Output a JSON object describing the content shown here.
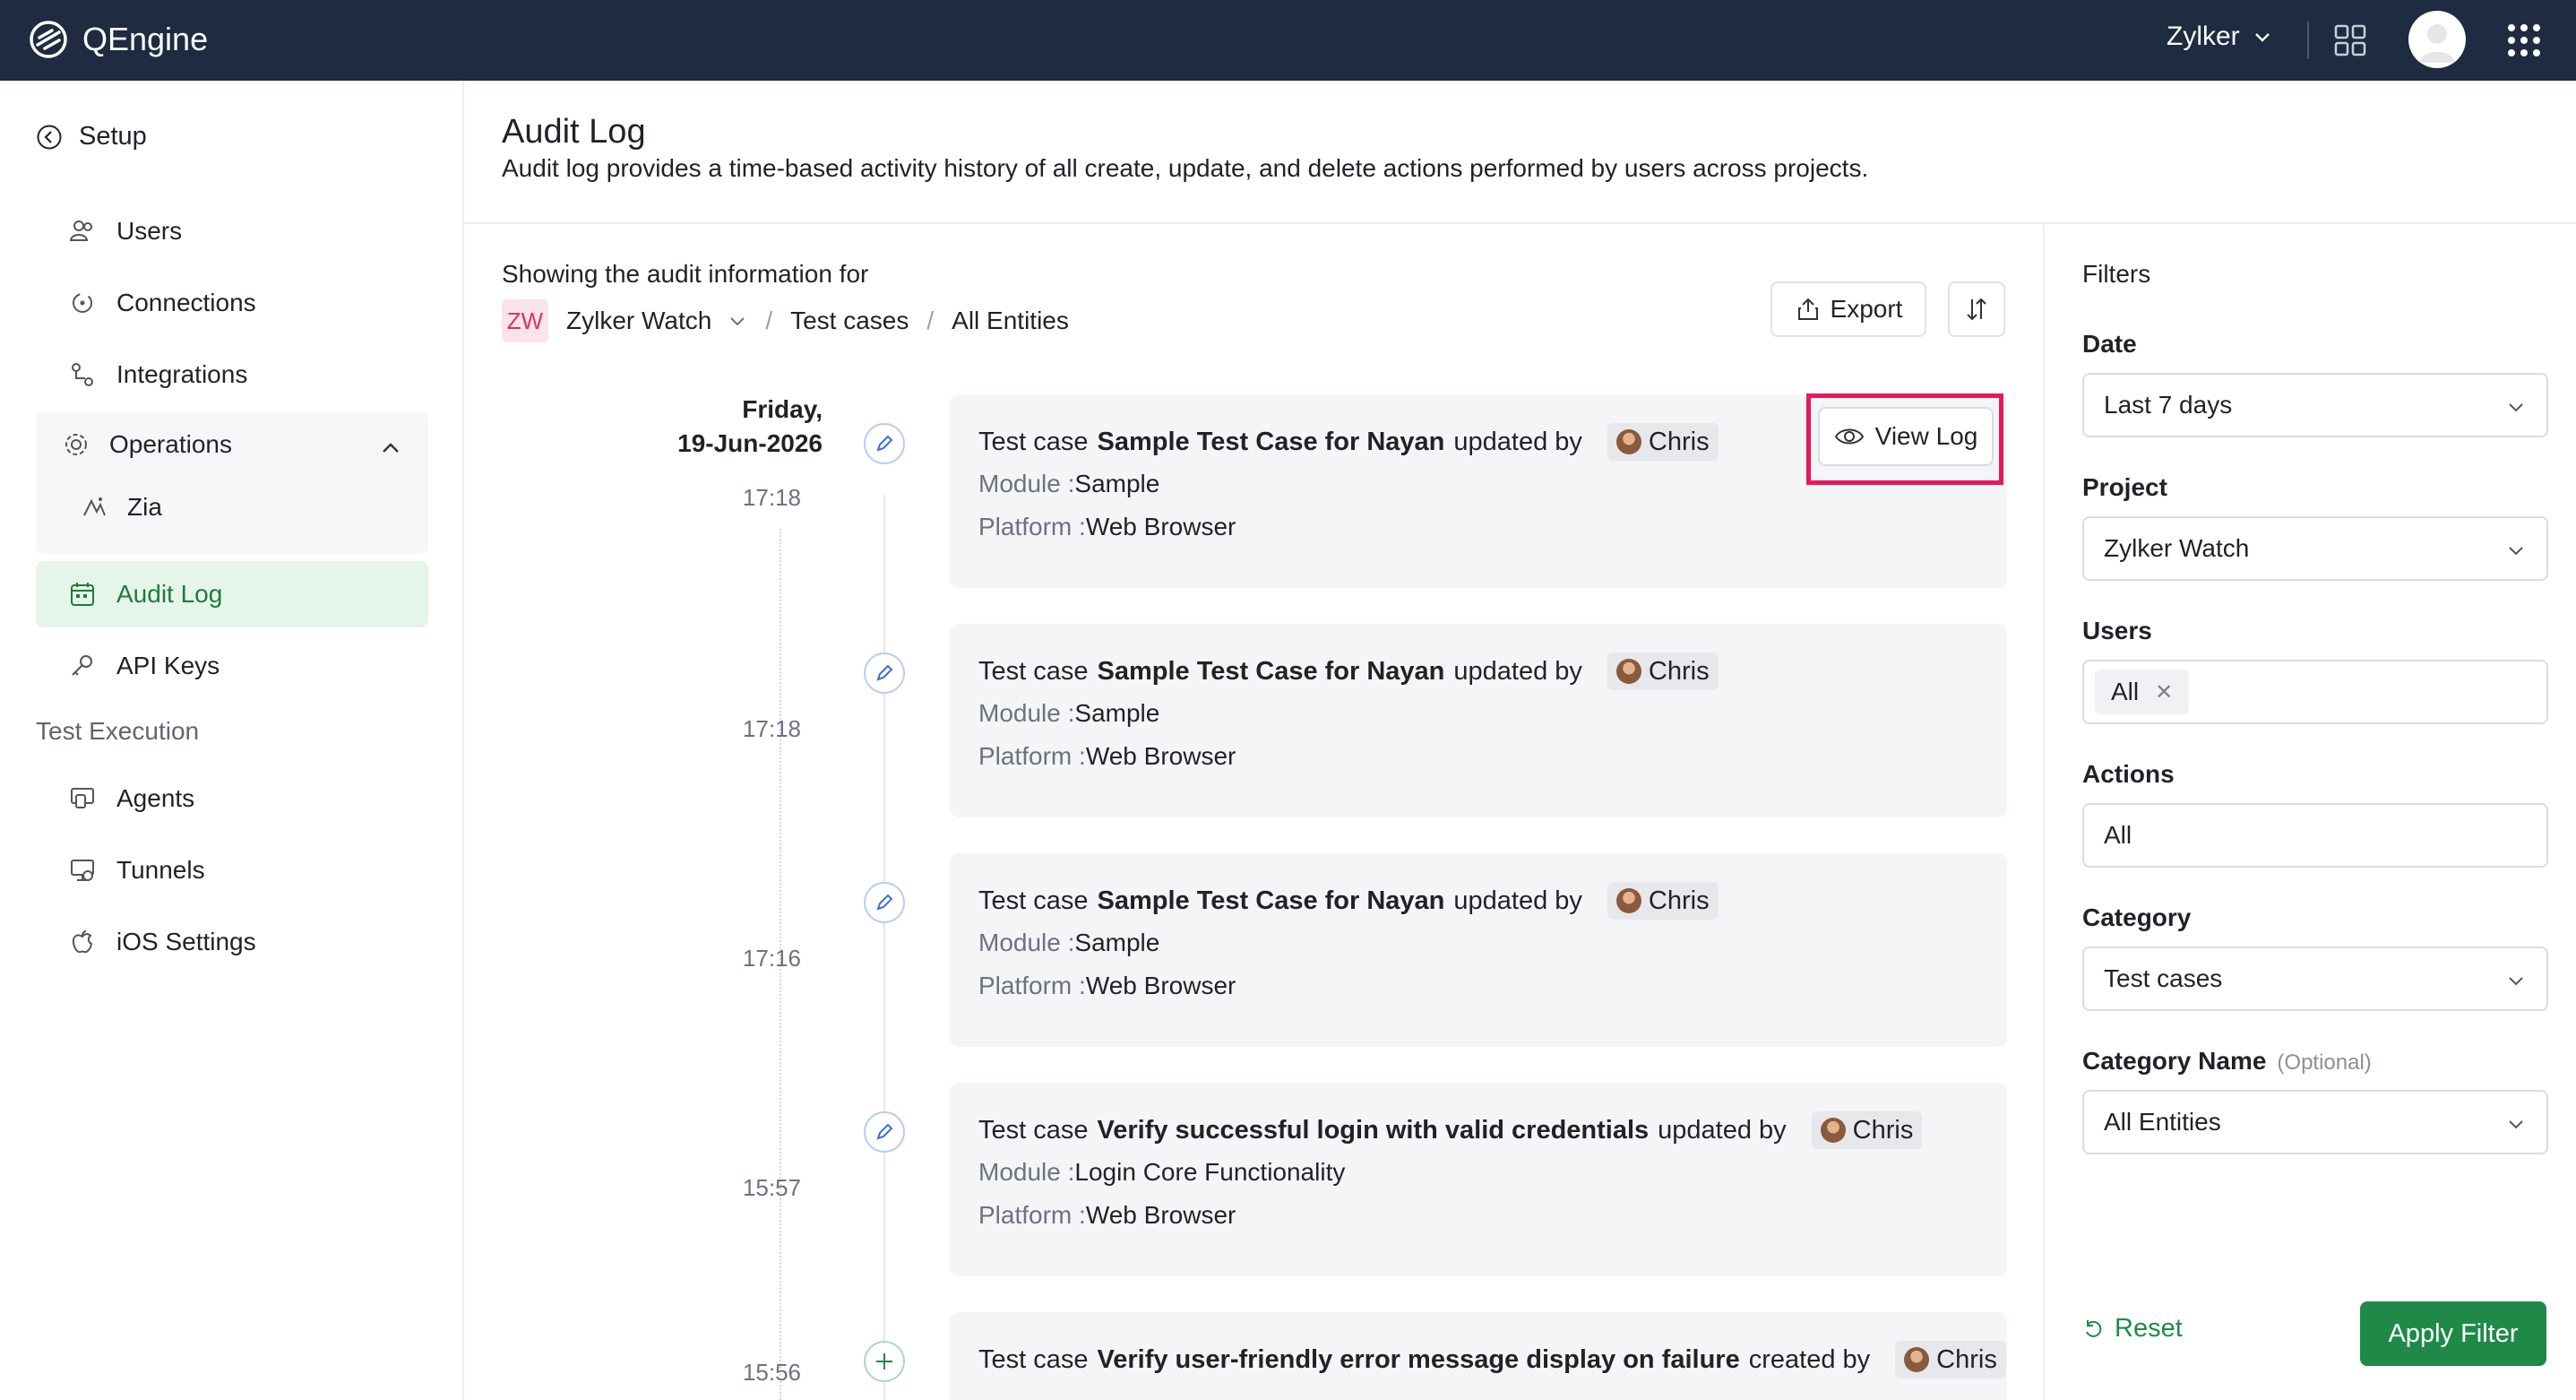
{
  "app": {
    "name": "QEngine",
    "org": "Zylker",
    "colors": {
      "topbar": "#1e2b40",
      "accent": "#1f8a47",
      "highlight": "#e8185a",
      "badge": "#d6336c"
    }
  },
  "sidebar": {
    "setup_label": "Setup",
    "items": [
      {
        "label": "Users",
        "icon": "users-icon"
      },
      {
        "label": "Connections",
        "icon": "connections-icon"
      },
      {
        "label": "Integrations",
        "icon": "integrations-icon"
      }
    ],
    "operations": {
      "label": "Operations",
      "children": [
        {
          "label": "Zia",
          "icon": "zia-icon"
        }
      ]
    },
    "audit_log": "Audit Log",
    "api_keys": "API Keys",
    "test_execution_label": "Test Execution",
    "exec_items": [
      {
        "label": "Agents",
        "icon": "agents-icon"
      },
      {
        "label": "Tunnels",
        "icon": "tunnels-icon"
      },
      {
        "label": "iOS Settings",
        "icon": "apple-icon"
      }
    ]
  },
  "header": {
    "title": "Audit Log",
    "description": "Audit log provides a time-based activity history of all create, update, and delete actions performed by users across projects."
  },
  "main": {
    "showing": "Showing the audit information for",
    "project_badge": "ZW",
    "project": "Zylker Watch",
    "crumb_sep": "/",
    "category": "Test cases",
    "entities": "All Entities",
    "export_label": "Export",
    "date_day": "Friday,",
    "date": "19-Jun-2026",
    "view_log_label": "View Log",
    "module_label": "Module :",
    "platform_label": "Platform :",
    "entries": [
      {
        "time": "17:18",
        "prefix": "Test case",
        "name": "Sample Test Case for Nayan",
        "action": "updated by",
        "user": "Chris",
        "module": "Sample",
        "platform": "Web Browser",
        "kind": "edit"
      },
      {
        "time": "17:18",
        "prefix": "Test case",
        "name": "Sample Test Case for Nayan",
        "action": "updated by",
        "user": "Chris",
        "module": "Sample",
        "platform": "Web Browser",
        "kind": "edit"
      },
      {
        "time": "17:16",
        "prefix": "Test case",
        "name": "Sample Test Case for Nayan",
        "action": "updated by",
        "user": "Chris",
        "module": "Sample",
        "platform": "Web Browser",
        "kind": "edit"
      },
      {
        "time": "15:57",
        "prefix": "Test case",
        "name": "Verify successful login with valid credentials",
        "action": "updated by",
        "user": "Chris",
        "module": "Login Core Functionality",
        "platform": "Web Browser",
        "kind": "edit"
      },
      {
        "time": "15:56",
        "prefix": "Test case",
        "name": "Verify user-friendly error message display on failure",
        "action": "created by",
        "user": "Chris",
        "kind": "create"
      }
    ]
  },
  "filters": {
    "title": "Filters",
    "date_label": "Date",
    "date_value": "Last 7 days",
    "project_label": "Project",
    "project_value": "Zylker Watch",
    "users_label": "Users",
    "users_chip": "All",
    "actions_label": "Actions",
    "actions_value": "All",
    "category_label": "Category",
    "category_value": "Test cases",
    "category_name_label": "Category Name",
    "optional": "(Optional)",
    "category_name_value": "All Entities",
    "reset_label": "Reset",
    "apply_label": "Apply Filter"
  }
}
